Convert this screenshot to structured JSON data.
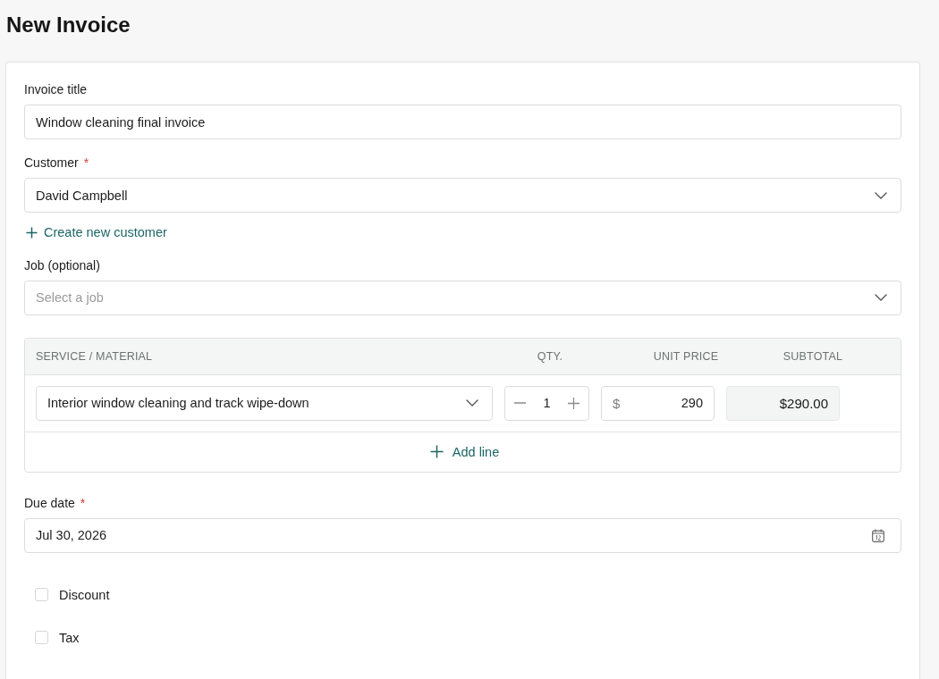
{
  "page": {
    "title": "New Invoice"
  },
  "form": {
    "title_field": {
      "label": "Invoice title",
      "value": "Window cleaning final invoice"
    },
    "customer_field": {
      "label": "Customer",
      "required_mark": "*",
      "value": "David Campbell"
    },
    "create_customer_link": {
      "label": "Create new customer"
    },
    "job_field": {
      "label": "Job (optional)",
      "placeholder": "Select a job"
    },
    "line_items": {
      "columns": [
        "SERVICE / MATERIAL",
        "QTY.",
        "UNIT PRICE",
        "SUBTOTAL"
      ],
      "rows": [
        {
          "service": "Interior window cleaning and track wipe-down",
          "quantity": "1",
          "currency": "$",
          "unit_price": "290",
          "subtotal": "$290.00"
        }
      ],
      "add_line": "Add line"
    },
    "due_date_field": {
      "label": "Due date",
      "required_mark": "*",
      "value": "Jul 30, 2026"
    },
    "options": [
      {
        "label": "Discount",
        "checked": false
      },
      {
        "label": "Tax",
        "checked": false
      }
    ]
  }
}
